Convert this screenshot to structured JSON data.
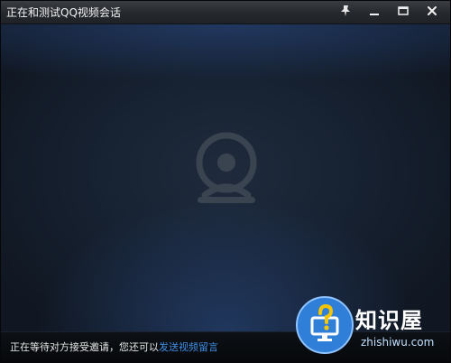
{
  "window": {
    "title": "正在和测试QQ视频会话",
    "controls": {
      "pin_icon": "pin-icon",
      "minimize_icon": "minimize-icon",
      "maximize_icon": "maximize-icon",
      "close_icon": "close-icon"
    }
  },
  "video": {
    "placeholder_icon": "webcam-icon"
  },
  "status": {
    "message": "正在等待对方接受邀请，您还可以",
    "link": "发送视频留言"
  },
  "watermark": {
    "title": "知识屋",
    "url": "zhishiwu.com",
    "icon": "question-monitor-icon"
  },
  "colors": {
    "link": "#3f8fe6",
    "watermark_blue": "#2f7fd8"
  }
}
